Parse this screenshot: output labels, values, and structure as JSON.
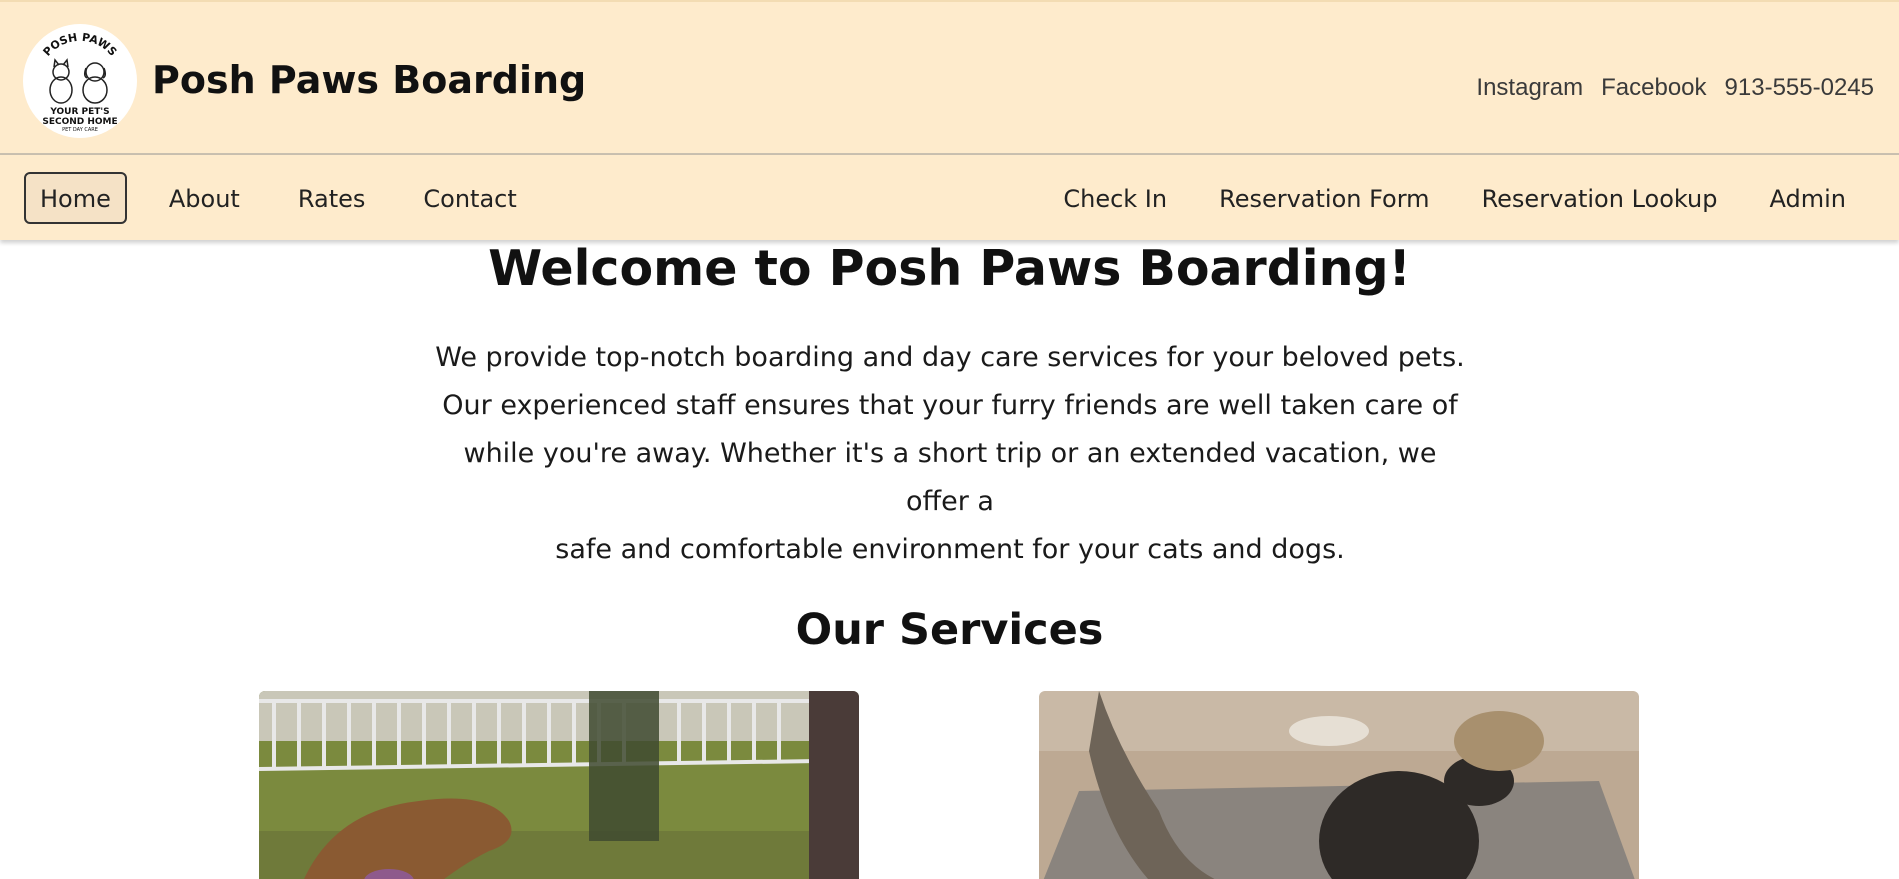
{
  "header": {
    "site_title": "Posh Paws Boarding",
    "logo": {
      "top_text": "POSH PAWS",
      "line1": "YOUR PET'S",
      "line2": "SECOND HOME",
      "line3": "PET DAY CARE"
    },
    "links": [
      "Instagram",
      "Facebook",
      "913-555-0245"
    ]
  },
  "nav": {
    "left": [
      "Home",
      "About",
      "Rates",
      "Contact"
    ],
    "right": [
      "Check In",
      "Reservation Form",
      "Reservation Lookup",
      "Admin"
    ],
    "active": "Home"
  },
  "main": {
    "welcome_title": "Welcome to Posh Paws Boarding!",
    "intro_lines": [
      "We provide top-notch boarding and day care services for your beloved pets.",
      "Our experienced staff ensures that your furry friends are well taken care of",
      "while you're away. Whether it's a short trip or an extended vacation, we offer a",
      "safe and comfortable environment for your cats and dogs."
    ],
    "services_title": "Our Services"
  },
  "colors": {
    "header_bg": "#feebcc",
    "text": "#111111"
  }
}
